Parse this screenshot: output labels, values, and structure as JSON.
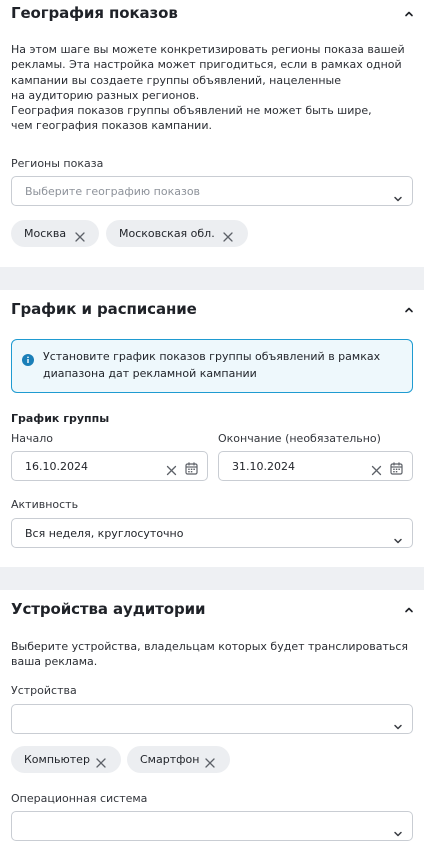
{
  "geo": {
    "title": "География показов",
    "description": "На этом шаге вы можете конкретизировать регионы показа вашей\nрекламы. Эта настройка может пригодиться, если в рамках одной\nкампании вы создаете группы объявлений, нацеленные\nна аудиторию разных регионов.\nГеография показов группы объявлений не может быть шире,\nчем география показов кампании.",
    "regions_label": "Регионы показа",
    "regions_placeholder": "Выберите географию показов",
    "chips": [
      "Москва",
      "Московская обл."
    ]
  },
  "schedule": {
    "title": "График и расписание",
    "info_text": "Установите график показов группы объявлений в рамках диапазона дат рекламной кампании",
    "group_label": "График группы",
    "start_label": "Начало",
    "start_value": "16.10.2024",
    "end_label": "Окончание (необязательно)",
    "end_value": "31.10.2024",
    "activity_label": "Активность",
    "activity_value": "Вся неделя, круглосуточно"
  },
  "devices": {
    "title": "Устройства аудитории",
    "description": "Выберите устройства, владельцам которых будет транслироваться\nваша реклама.",
    "devices_label": "Устройства",
    "devices_value": "",
    "chips": [
      "Компьютер",
      "Смартфон"
    ],
    "os_label": "Операционная система",
    "os_value": ""
  },
  "colors": {
    "info_border": "#1f9bd1",
    "info_bg": "#eef8fc",
    "divider": "#eef0f3",
    "chip_bg": "#eceef1"
  },
  "icons": {
    "collapse": "chevron-up-icon",
    "dropdown": "chevron-down-icon",
    "remove": "close-icon",
    "info": "info-icon",
    "calendar": "calendar-icon"
  }
}
